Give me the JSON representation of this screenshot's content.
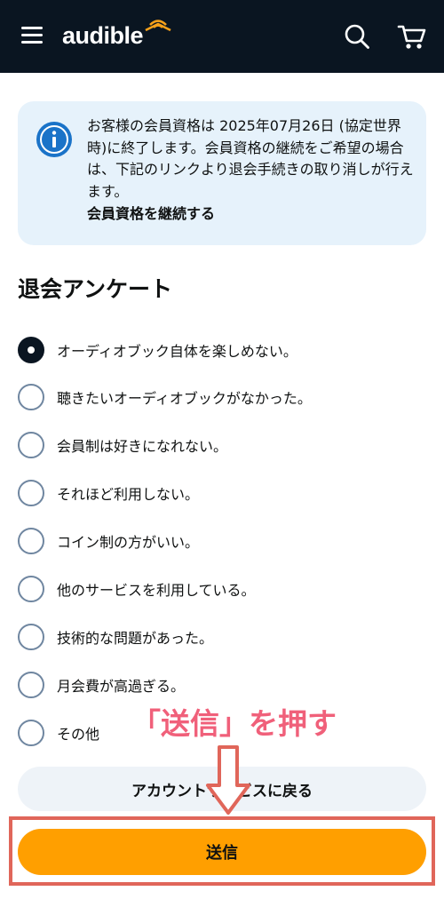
{
  "header": {
    "logo_text": "audible",
    "background": "#0a1521"
  },
  "notice": {
    "text": "お客様の会員資格は 2025年07月26日 (協定世界時)に終了します。会員資格の継続をご希望の場合は、下記のリンクより退会手続きの取り消しが行えます。",
    "link_label": "会員資格を継続する",
    "background": "#e6f2fb"
  },
  "survey": {
    "title": "退会アンケート",
    "selected_index": 0,
    "options": [
      "オーディオブック自体を楽しめない。",
      "聴きたいオーディオブックがなかった。",
      "会員制は好きになれない。",
      "それほど利用しない。",
      "コイン制の方がいい。",
      "他のサービスを利用している。",
      "技術的な問題があった。",
      "月会費が高過ぎる。",
      "その他"
    ]
  },
  "annotation": {
    "text": "「送信」を押す",
    "color": "#f0607a"
  },
  "buttons": {
    "back_label": "アカウントサービスに戻る",
    "submit_label": "送信",
    "submit_color": "#ff9f00"
  },
  "icons": {
    "menu": "hamburger-icon",
    "search": "search-icon",
    "cart": "cart-icon",
    "info": "info-icon"
  }
}
